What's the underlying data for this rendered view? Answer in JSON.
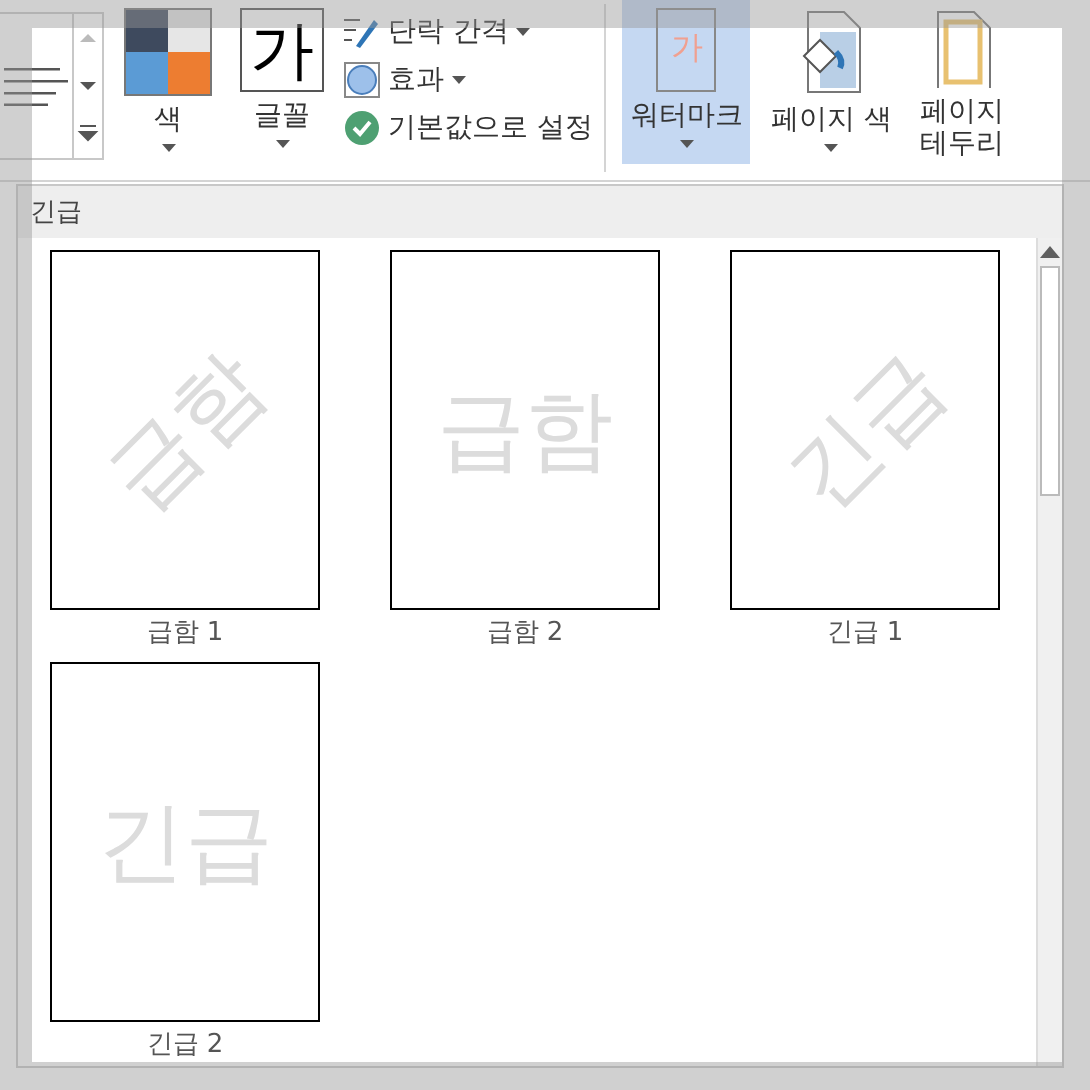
{
  "ribbon": {
    "small_buttons": [
      {
        "kind": "spacing",
        "label": "단락 간격",
        "dropdown": true
      },
      {
        "kind": "effects",
        "label": "효과",
        "dropdown": true
      },
      {
        "kind": "default",
        "label": "기본값으로 설정",
        "dropdown": false
      }
    ],
    "large_buttons": [
      {
        "kind": "colors",
        "label": "색",
        "dropdown": true,
        "selected": false
      },
      {
        "kind": "fonts",
        "label": "글꼴",
        "glyph": "가",
        "dropdown": true,
        "selected": false
      }
    ],
    "page_buttons": [
      {
        "kind": "watermark",
        "label": "워터마크",
        "glyph": "가",
        "dropdown": true,
        "selected": true
      },
      {
        "kind": "pagecolor",
        "label": "페이지 색",
        "dropdown": true,
        "selected": false
      },
      {
        "kind": "border",
        "label": "페이지 테두리",
        "dropdown": false,
        "selected": false
      }
    ]
  },
  "gallery": {
    "heading": "긴급",
    "items": [
      {
        "label": "급함 1",
        "watermark": "급함",
        "kind": "diagonal"
      },
      {
        "label": "급함 2",
        "watermark": "급함",
        "kind": "horizontal"
      },
      {
        "label": "긴급 1",
        "watermark": "긴급",
        "kind": "diagonal"
      },
      {
        "label": "긴급 2",
        "watermark": "긴급",
        "kind": "horizontal"
      }
    ]
  }
}
